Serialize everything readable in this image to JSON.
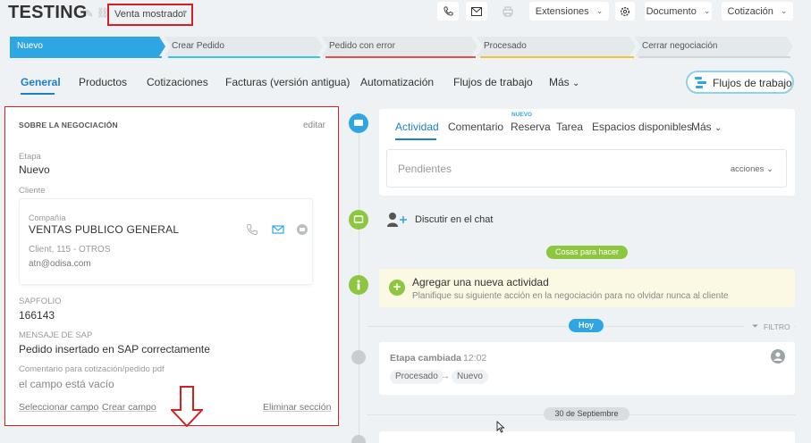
{
  "header": {
    "title": "TESTING",
    "category": "Venta mostrador",
    "buttons": {
      "extensiones": "Extensiones",
      "documento": "Documento",
      "cotizacion": "Cotización"
    }
  },
  "stages": [
    {
      "label": "Nuevo",
      "color": "#2fa6e4"
    },
    {
      "label": "Crear Pedido",
      "color": "#3dc1e8"
    },
    {
      "label": "Pedido con error",
      "color": "#e24f4f"
    },
    {
      "label": "Procesado",
      "color": "#f3c13a"
    },
    {
      "label": "Cerrar negociación",
      "color": "#cfd6da"
    }
  ],
  "tabs": [
    "General",
    "Productos",
    "Cotizaciones",
    "Facturas (versión antigua)",
    "Automatización",
    "Flujos de trabajo",
    "Más"
  ],
  "workflow_button": "Flujos de trabajo",
  "left_panel": {
    "title": "SOBRE LA NEGOCIACIÓN",
    "edit": "editar",
    "etapa_label": "Etapa",
    "etapa_value": "Nuevo",
    "cliente_label": "Cliente",
    "client": {
      "type": "Compañía",
      "name": "VENTAS PUBLICO GENERAL",
      "subtitle": "Client, 115 - OTROS",
      "email": "atn@odisa.com"
    },
    "sapfolio_label": "SAPFOLIO",
    "sapfolio_value": "166143",
    "mensaje_label": "MENSAJE DE SAP",
    "mensaje_value": "Pedido insertado en SAP correctamente",
    "comentario_label": "Comentario para cotización/pedido pdf",
    "comentario_value": "el campo está vacío",
    "links": {
      "select": "Seleccionar campo",
      "create": "Crear campo",
      "delete": "Eliminar sección"
    }
  },
  "activity": {
    "tabs": [
      "Actividad",
      "Comentario",
      "Reserva",
      "Tarea",
      "Espacios disponibles",
      "Más"
    ],
    "new_badge": "NUEVO",
    "pending_placeholder": "Pendientes",
    "actions": "acciones"
  },
  "chat": {
    "label": "Discutir en el chat"
  },
  "todo_pill": "Cosas para hacer",
  "todo": {
    "title": "Agregar una nueva actividad",
    "subtitle": "Planifique su siguiente acción en la negociación para no olvidar nunca al cliente"
  },
  "today_pill": "Hoy",
  "filter": "FILTRO",
  "stage_change": {
    "title": "Etapa cambiada",
    "time": "12:02",
    "from": "Procesado",
    "to": "Nuevo"
  },
  "date_pill": "30 de Septiembre",
  "colors": {
    "accent": "#1f7fc4",
    "highlight_border": "#d42020",
    "todo_green": "#8dc63f"
  }
}
